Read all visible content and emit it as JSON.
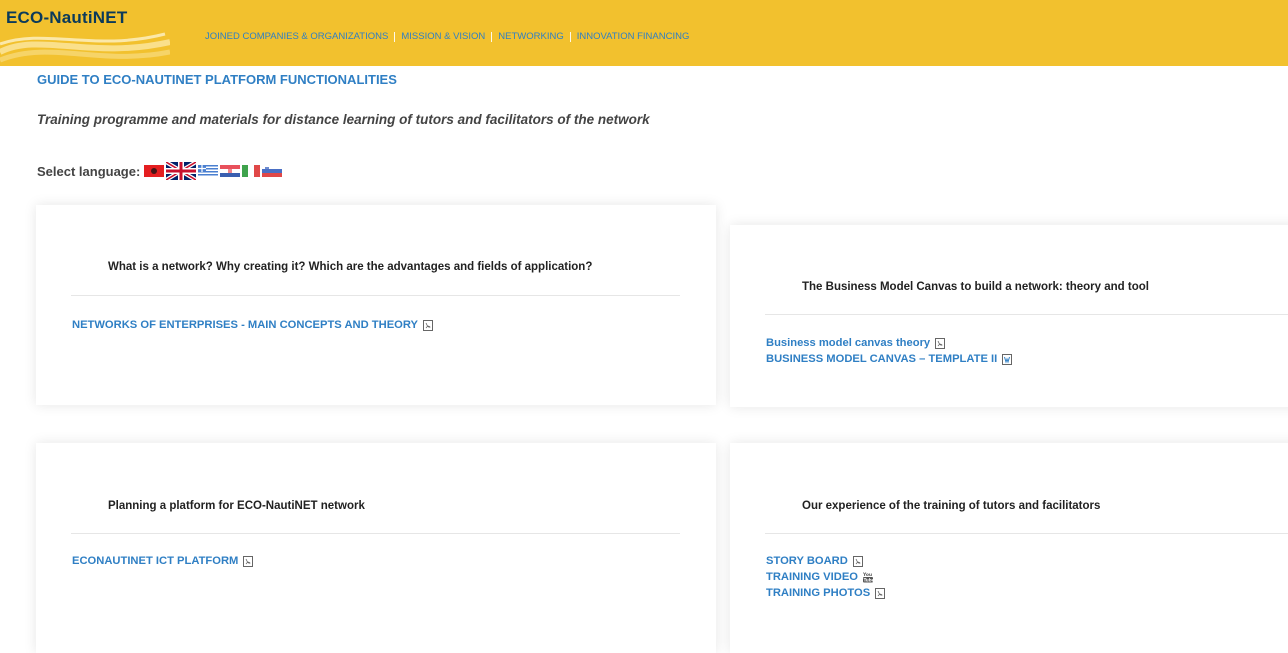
{
  "header": {
    "logo_text": "ECO-NautiNET",
    "nav": [
      {
        "label": "JOINED COMPANIES & ORGANIZATIONS"
      },
      {
        "label": "MISSION & VISION"
      },
      {
        "label": "NETWORKING"
      },
      {
        "label": "INNOVATION FINANCING"
      }
    ]
  },
  "page": {
    "title": "GUIDE TO ECO-NAUTINET PLATFORM FUNCTIONALITIES",
    "subtitle": "Training programme and materials for distance learning of tutors and facilitators of the network",
    "language_label": "Select language:"
  },
  "cards": [
    {
      "heading": "What is a network? Why creating it? Which are the advantages and fields of application?",
      "links": [
        {
          "label": "NETWORKS OF ENTERPRISES - MAIN CONCEPTS AND THEORY",
          "icon": "pdf-icon"
        }
      ]
    },
    {
      "heading": "The Business Model Canvas to build a network: theory and tool",
      "links": [
        {
          "label": "Business model canvas theory",
          "icon": "pdf-icon"
        },
        {
          "label": "BUSINESS MODEL CANVAS – TEMPLATE II",
          "icon": "doc-icon"
        }
      ]
    },
    {
      "heading": "Planning a platform for ECO-NautiNET network",
      "links": [
        {
          "label": "ECONAUTINET ICT PLATFORM",
          "icon": "pdf-icon"
        }
      ]
    },
    {
      "heading": "Our experience of the training of tutors and facilitators",
      "links": [
        {
          "label": "STORY BOARD",
          "icon": "pdf-icon"
        },
        {
          "label": "TRAINING VIDEO",
          "icon": "youtube-icon"
        },
        {
          "label": "TRAINING PHOTOS",
          "icon": "pdf-icon"
        }
      ]
    }
  ],
  "colors": {
    "header_bg": "#f2c12e",
    "link_blue": "#2f7fc4"
  }
}
